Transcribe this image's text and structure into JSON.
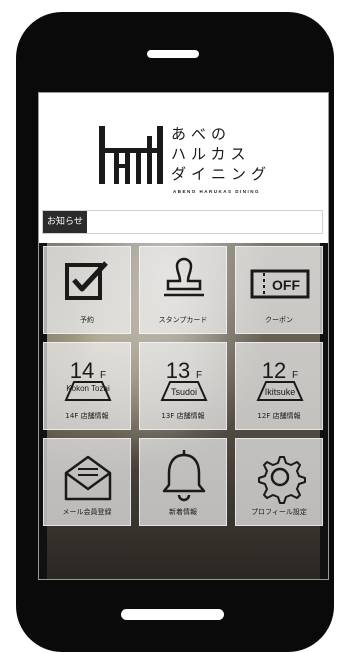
{
  "brand": {
    "name_line1": "あべの",
    "name_line2": "ハルカス",
    "name_line3": "ダイニング",
    "subtitle": "ABENO HARUKAS DINING"
  },
  "notice": {
    "label": "お知らせ"
  },
  "menu": {
    "items": [
      {
        "label": "予約",
        "icon": "checkbox-icon"
      },
      {
        "label": "スタンプカード",
        "icon": "stamp-icon"
      },
      {
        "label": "クーポン",
        "icon": "coupon-icon",
        "badge": "OFF"
      },
      {
        "label": "14F 店舗情報",
        "icon": "floor-14-icon",
        "floor": "14",
        "unit": "F",
        "name": "Kokon Tozai"
      },
      {
        "label": "13F 店舗情報",
        "icon": "floor-13-icon",
        "floor": "13",
        "unit": "F",
        "name": "Tsudoi"
      },
      {
        "label": "12F 店舗情報",
        "icon": "floor-12-icon",
        "floor": "12",
        "unit": "F",
        "name": "Ikitsuke"
      },
      {
        "label": "メール会員登録",
        "icon": "mail-icon"
      },
      {
        "label": "新着情報",
        "icon": "bell-icon"
      },
      {
        "label": "プロフィール設定",
        "icon": "gear-icon"
      }
    ]
  }
}
